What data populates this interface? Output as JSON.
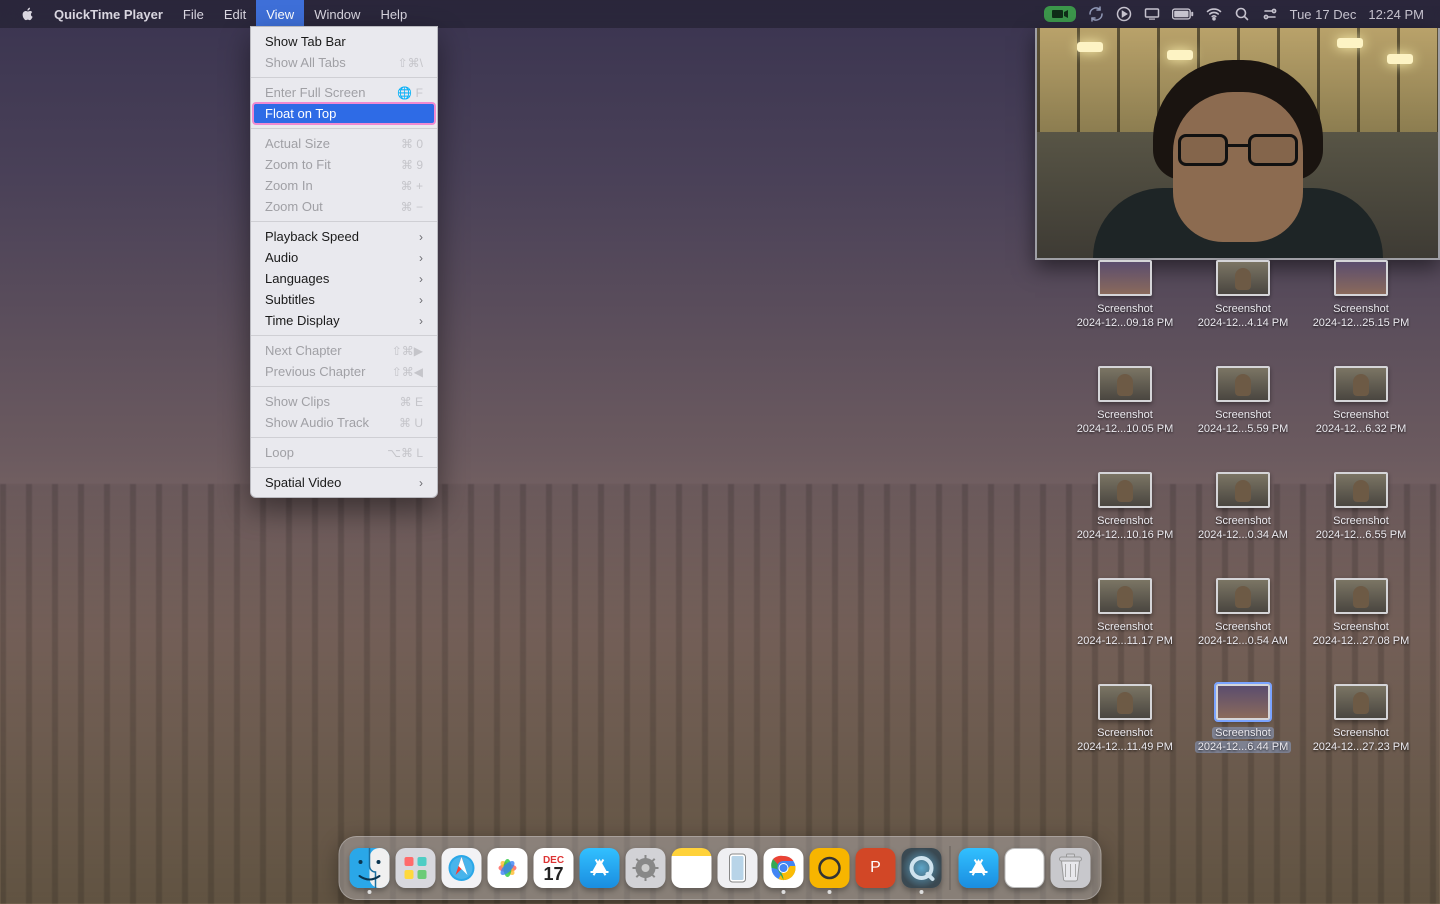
{
  "menubar": {
    "app_name": "QuickTime Player",
    "items": [
      "File",
      "Edit",
      "View",
      "Window",
      "Help"
    ],
    "active_item": "View",
    "date": "Tue 17 Dec",
    "time": "12:24 PM"
  },
  "view_menu": {
    "sections": [
      [
        {
          "label": "Show Tab Bar",
          "shortcut": "",
          "enabled": true
        },
        {
          "label": "Show All Tabs",
          "shortcut": "⇧⌘\\",
          "enabled": false
        }
      ],
      [
        {
          "label": "Enter Full Screen",
          "shortcut": "🌐 F",
          "enabled": false
        },
        {
          "label": "Float on Top",
          "shortcut": "",
          "enabled": true,
          "highlighted": true
        }
      ],
      [
        {
          "label": "Actual Size",
          "shortcut": "⌘ 0",
          "enabled": false
        },
        {
          "label": "Zoom to Fit",
          "shortcut": "⌘ 9",
          "enabled": false
        },
        {
          "label": "Zoom In",
          "shortcut": "⌘ +",
          "enabled": false
        },
        {
          "label": "Zoom Out",
          "shortcut": "⌘ −",
          "enabled": false
        }
      ],
      [
        {
          "label": "Playback Speed",
          "submenu": true,
          "enabled": true
        },
        {
          "label": "Audio",
          "submenu": true,
          "enabled": true
        },
        {
          "label": "Languages",
          "submenu": true,
          "enabled": true
        },
        {
          "label": "Subtitles",
          "submenu": true,
          "enabled": true
        },
        {
          "label": "Time Display",
          "submenu": true,
          "enabled": true
        }
      ],
      [
        {
          "label": "Next Chapter",
          "shortcut": "⇧⌘▶",
          "enabled": false
        },
        {
          "label": "Previous Chapter",
          "shortcut": "⇧⌘◀",
          "enabled": false
        }
      ],
      [
        {
          "label": "Show Clips",
          "shortcut": "⌘ E",
          "enabled": false
        },
        {
          "label": "Show Audio Track",
          "shortcut": "⌘ U",
          "enabled": false
        }
      ],
      [
        {
          "label": "Loop",
          "shortcut": "⌥⌘ L",
          "enabled": false
        }
      ],
      [
        {
          "label": "Spatial Video",
          "submenu": true,
          "enabled": true
        }
      ]
    ]
  },
  "desktop_files": [
    {
      "l1": "Screenshot",
      "l2": "2024-12...09.18 PM",
      "sky": true
    },
    {
      "l1": "Screenshot",
      "l2": "2024-12...4.14 PM"
    },
    {
      "l1": "Screenshot",
      "l2": "2024-12...25.15 PM",
      "sky": true
    },
    {
      "l1": "Screenshot",
      "l2": "2024-12...10.05 PM"
    },
    {
      "l1": "Screenshot",
      "l2": "2024-12...5.59 PM"
    },
    {
      "l1": "Screenshot",
      "l2": "2024-12...6.32 PM"
    },
    {
      "l1": "Screenshot",
      "l2": "2024-12...10.16 PM"
    },
    {
      "l1": "Screenshot",
      "l2": "2024-12...0.34 AM"
    },
    {
      "l1": "Screenshot",
      "l2": "2024-12...6.55 PM"
    },
    {
      "l1": "Screenshot",
      "l2": "2024-12...11.17 PM"
    },
    {
      "l1": "Screenshot",
      "l2": "2024-12...0.54 AM"
    },
    {
      "l1": "Screenshot",
      "l2": "2024-12...27.08 PM"
    },
    {
      "l1": "Screenshot",
      "l2": "2024-12...11.49 PM"
    },
    {
      "l1": "Screenshot",
      "l2": "2024-12...6.44 PM",
      "sky": true,
      "selected": true
    },
    {
      "l1": "Screenshot",
      "l2": "2024-12...27.23 PM"
    }
  ],
  "calendar": {
    "month_abbr": "DEC",
    "day": "17"
  },
  "dock": [
    {
      "name": "finder",
      "cls": "di-finder",
      "running": true
    },
    {
      "name": "launchpad",
      "cls": "di-launchpad"
    },
    {
      "name": "safari",
      "cls": "di-safari"
    },
    {
      "name": "photos",
      "cls": "di-photos"
    },
    {
      "name": "calendar",
      "cls": "di-calendar"
    },
    {
      "name": "app-store",
      "cls": "di-appstore"
    },
    {
      "name": "system-settings",
      "cls": "di-settings"
    },
    {
      "name": "notes",
      "cls": "di-notes"
    },
    {
      "name": "iphone-mirroring",
      "cls": "di-iphone"
    },
    {
      "name": "chrome",
      "cls": "di-chrome",
      "running": true
    },
    {
      "name": "amie",
      "cls": "di-amie",
      "running": true
    },
    {
      "name": "powerpoint",
      "cls": "di-ppt"
    },
    {
      "name": "quicktime",
      "cls": "di-quicktime",
      "running": true
    }
  ],
  "dock_right": [
    {
      "name": "app-store-2",
      "cls": "di-appstore2"
    },
    {
      "name": "textedit-doc",
      "cls": "di-textedit"
    },
    {
      "name": "trash",
      "cls": "di-trash"
    }
  ]
}
